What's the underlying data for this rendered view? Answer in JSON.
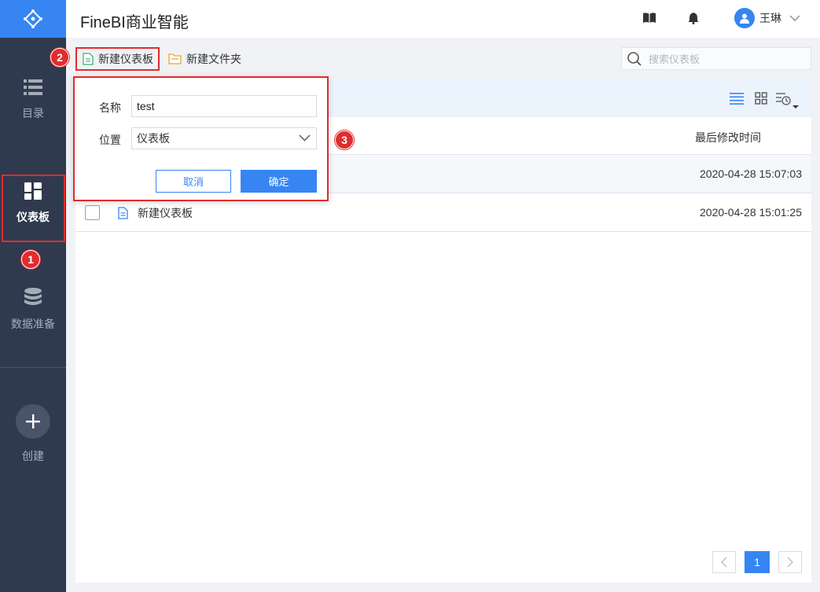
{
  "app": {
    "title": "FineBI商业智能"
  },
  "sidebar": {
    "items": [
      {
        "label": "目录",
        "icon": "list-icon"
      },
      {
        "label": "仪表板",
        "icon": "dashboard-icon",
        "active": true
      },
      {
        "label": "数据准备",
        "icon": "database-icon"
      },
      {
        "label": "创建",
        "icon": "plus-icon"
      }
    ]
  },
  "header": {
    "user_name": "王琳"
  },
  "toolbar": {
    "new_dashboard_label": "新建仪表板",
    "new_folder_label": "新建文件夹",
    "search_placeholder": "搜索仪表板"
  },
  "table": {
    "col_modified": "最后修改时间",
    "rows": [
      {
        "name": "",
        "modified": "2020-04-28 15:07:03"
      },
      {
        "name": "新建仪表板",
        "modified": "2020-04-28 15:01:25"
      }
    ]
  },
  "pagination": {
    "current": "1"
  },
  "popup": {
    "name_label": "名称",
    "name_value": "test",
    "location_label": "位置",
    "location_value": "仪表板",
    "cancel_label": "取消",
    "ok_label": "确定"
  },
  "annotations": {
    "m1": "1",
    "m2": "2",
    "m3": "3"
  },
  "colors": {
    "accent": "#3685f2",
    "sidebar_bg": "#2f3a4f",
    "highlight": "#e02d2d"
  }
}
